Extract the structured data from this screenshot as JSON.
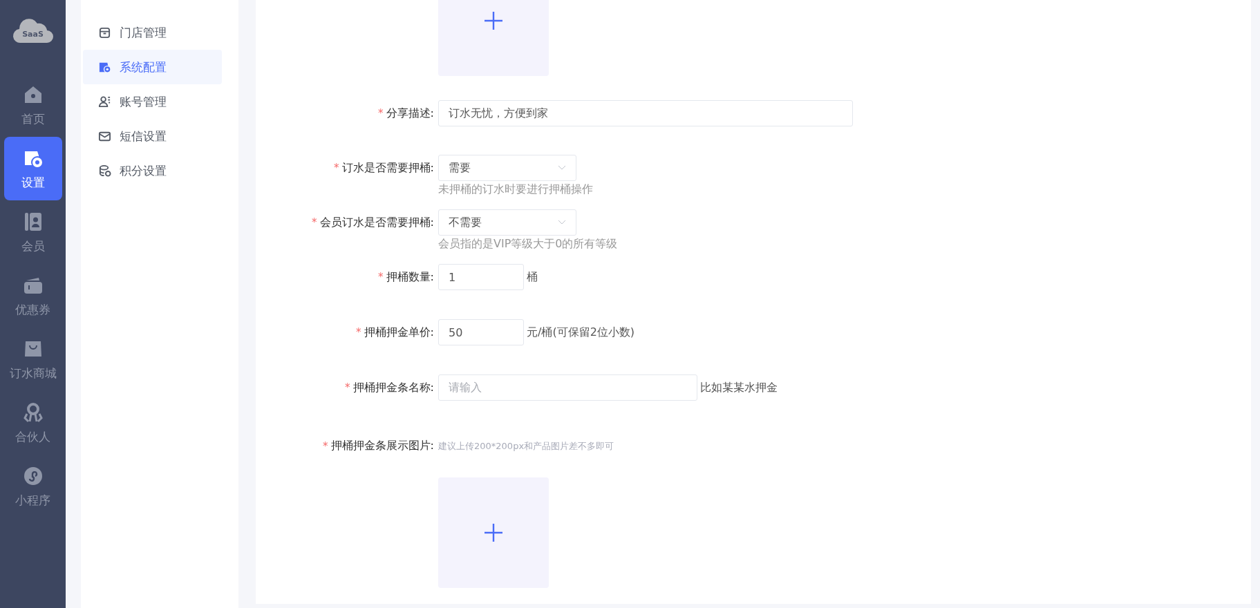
{
  "logo": {
    "text": "SaaS"
  },
  "nav": [
    {
      "label": "首页",
      "selected": false
    },
    {
      "label": "设置",
      "selected": true
    },
    {
      "label": "会员",
      "selected": false
    },
    {
      "label": "优惠券",
      "selected": false
    },
    {
      "label": "订水商城",
      "selected": false
    },
    {
      "label": "合伙人",
      "selected": false
    },
    {
      "label": "小程序",
      "selected": false
    }
  ],
  "submenu": [
    {
      "label": "门店管理",
      "selected": false
    },
    {
      "label": "系统配置",
      "selected": true
    },
    {
      "label": "账号管理",
      "selected": false
    },
    {
      "label": "短信设置",
      "selected": false
    },
    {
      "label": "积分设置",
      "selected": false
    }
  ],
  "form": [
    {
      "kind": "upload"
    },
    {
      "kind": "text",
      "label": "分享描述:",
      "mark": "*",
      "value": "订水无忧，方便到家"
    },
    {
      "kind": "select",
      "label": "订水是否需要押桶:",
      "mark": "*",
      "value": "需要",
      "hint": "未押桶的订水时要进行押桶操作"
    },
    {
      "kind": "select",
      "label": "会员订水是否需要押桶:",
      "mark": "*",
      "value": "不需要",
      "hint": "会员指的是VIP等级大于0的所有等级"
    },
    {
      "kind": "number",
      "label": "押桶数量:",
      "mark": "*",
      "value": "1",
      "suffix": "桶"
    },
    {
      "kind": "number",
      "label": "押桶押金单价:",
      "mark": "*",
      "value": "50",
      "suffix": "元/桶(可保留2位小数)"
    },
    {
      "kind": "text-suffix",
      "label": "押桶押金条名称:",
      "mark": "*",
      "placeholder": "请输入",
      "suffix": "比如某某水押金"
    },
    {
      "kind": "upload",
      "label": "押桶押金条展示图片:",
      "mark": "*",
      "tip": "建议上传200*200px和产品图片差不多即可"
    }
  ]
}
